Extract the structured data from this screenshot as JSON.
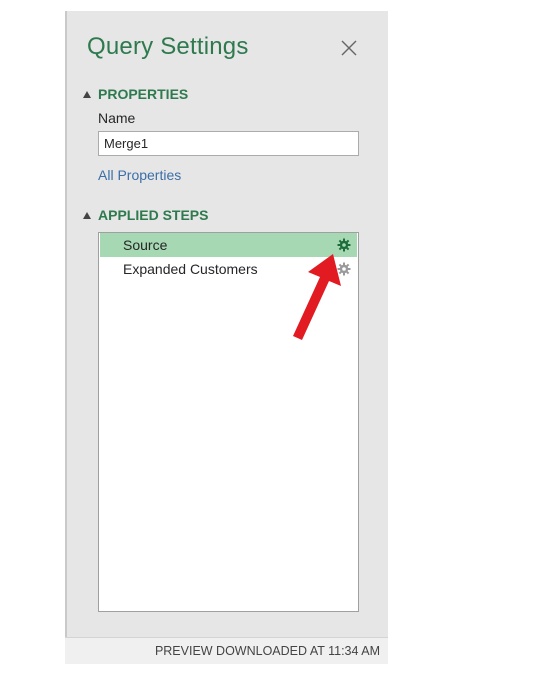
{
  "pane": {
    "title": "Query Settings",
    "close_icon": "close-icon"
  },
  "properties": {
    "heading": "PROPERTIES",
    "name_label": "Name",
    "name_value": "Merge1",
    "all_properties_link": "All Properties"
  },
  "applied_steps": {
    "heading": "APPLIED STEPS",
    "steps": [
      {
        "label": "Source",
        "selected": true,
        "icon": "gear-icon"
      },
      {
        "label": "Expanded Customers",
        "selected": false,
        "icon": "gear-icon"
      }
    ]
  },
  "status": {
    "text": "PREVIEW DOWNLOADED AT 11:34 AM"
  },
  "colors": {
    "accent": "#2e7a4e",
    "selected_row": "#a5d8b3",
    "link": "#3b6fa8",
    "annotation_arrow": "#e21b23"
  }
}
